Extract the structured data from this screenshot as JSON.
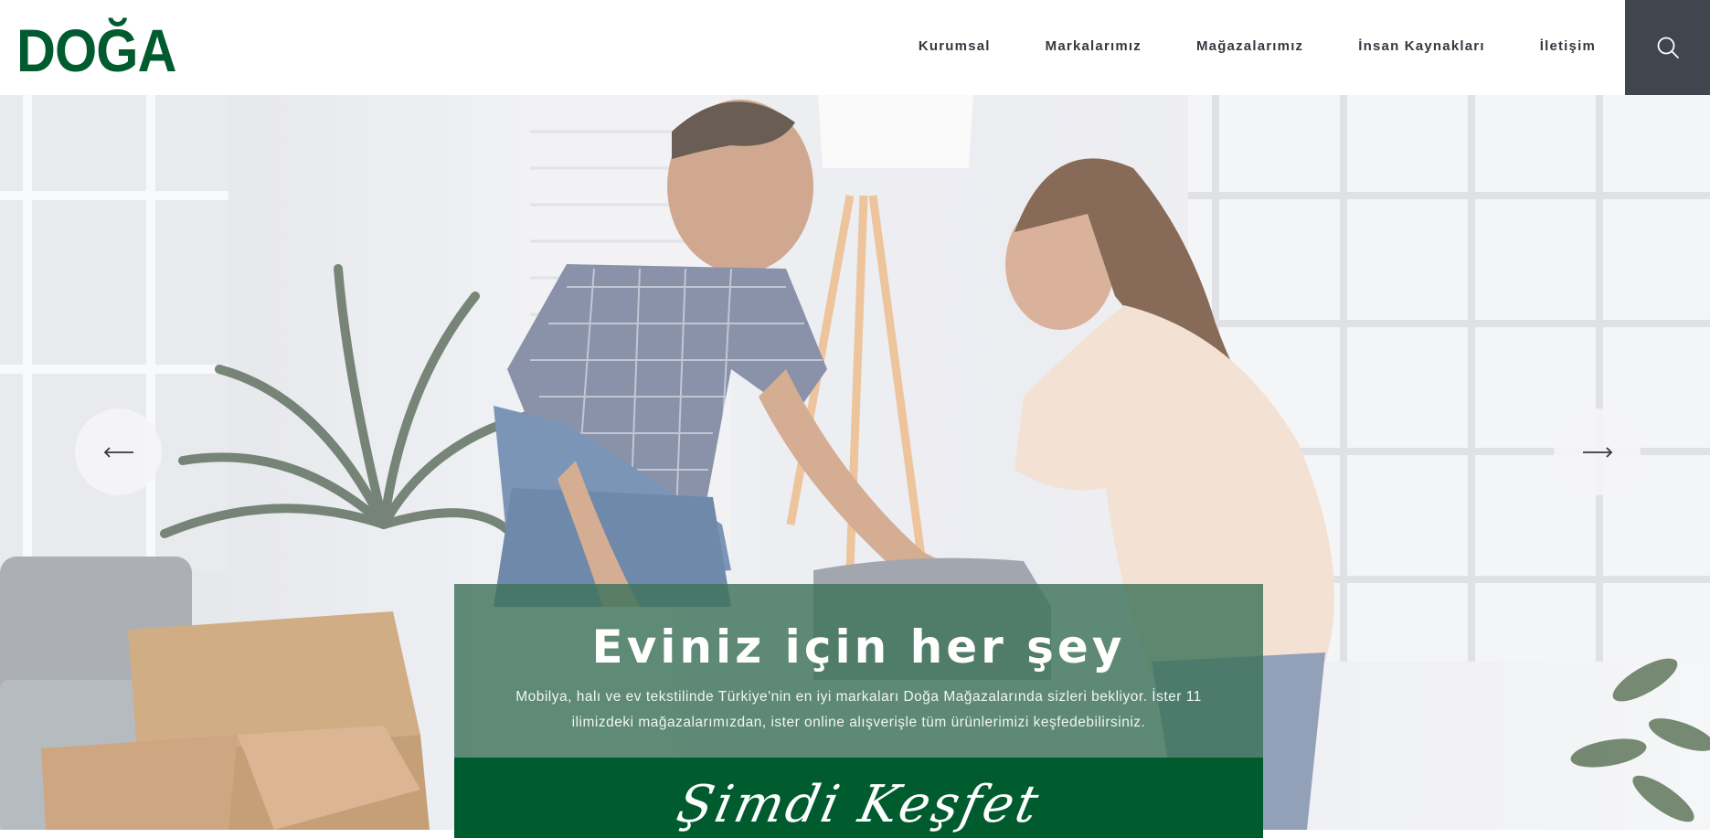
{
  "brand": {
    "logo_text": "DOĞA",
    "color": "#005c2f"
  },
  "nav": {
    "items": [
      {
        "label": "Kurumsal"
      },
      {
        "label": "Markalarımız"
      },
      {
        "label": "Mağazalarımız"
      },
      {
        "label": "İnsan Kaynakları"
      },
      {
        "label": "İletişim"
      }
    ],
    "search_icon": "search-icon"
  },
  "hero": {
    "title": "Eviniz için her şey",
    "description": "Mobilya, halı ve ev tekstilinde Türkiye'nin en iyi markaları Doğa Mağazalarında sizleri bekliyor. İster 11 ilimizdeki mağazalarımızdan, ister online alışverişle tüm ürünlerimizi keşfedebilirsiniz.",
    "cta_label": "Şimdi Keşfet",
    "prev_icon": "arrow-left-icon",
    "next_icon": "arrow-right-icon",
    "caption_color": "#3e735a",
    "cta_color": "#005c2f"
  }
}
